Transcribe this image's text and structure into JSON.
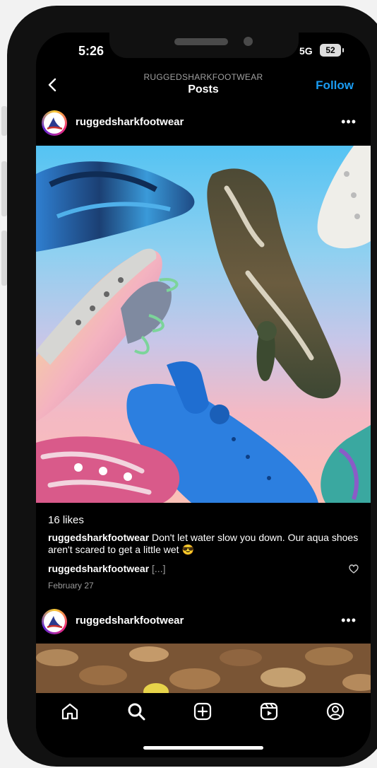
{
  "status_bar": {
    "time": "5:26",
    "network": "5G",
    "battery": "52"
  },
  "header": {
    "account": "RUGGEDSHARKFOOTWEAR",
    "title": "Posts",
    "follow_label": "Follow"
  },
  "posts": [
    {
      "username": "ruggedsharkfootwear",
      "likes": "16 likes",
      "caption_user": "ruggedsharkfootwear",
      "caption_text": "Don't let water slow you down. Our aqua shoes aren't scared to get a little wet 😎",
      "comment_user": "ruggedsharkfootwear",
      "comment_more": "[...]",
      "date": "February 27"
    },
    {
      "username": "ruggedsharkfootwear"
    }
  ],
  "icons": {
    "tabs": [
      "home-icon",
      "search-icon",
      "create-post-icon",
      "reels-icon",
      "profile-icon"
    ],
    "header": [
      "back-icon",
      "more-options-icon",
      "heart-icon"
    ]
  },
  "colors": {
    "accent": "#1a9cf2",
    "background": "#000000",
    "secondary_text": "#9a9a9a"
  }
}
